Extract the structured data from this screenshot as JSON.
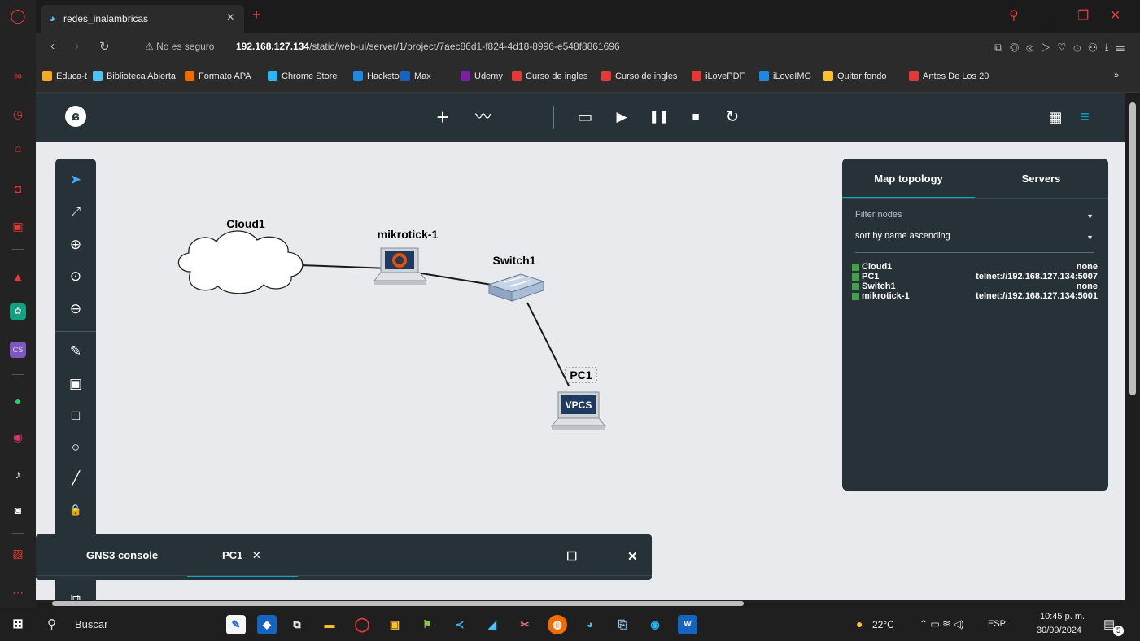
{
  "browser": {
    "tab_title": "redes_inalambricas",
    "tab_close": "×",
    "new_tab": "+",
    "security": "⚠ No es seguro",
    "url_host": "192.168.127.134",
    "url_path": "/static/web-ui/server/1/project/7aec86d1-f824-4d18-8996-e548f8861696",
    "bookmarks": [
      {
        "label": "Educa-t",
        "color": "#f9a825"
      },
      {
        "label": "Biblioteca Abierta",
        "color": "#4fc3f7"
      },
      {
        "label": "Formato APA",
        "color": "#ef6c00"
      },
      {
        "label": "Chrome Store",
        "color": "#29b6f6"
      },
      {
        "label": "Hackstore",
        "color": "#1e88e5"
      },
      {
        "label": "Max",
        "color": "#1565c0"
      },
      {
        "label": "Udemy",
        "color": "#7b1fa2"
      },
      {
        "label": "Curso de ingles",
        "color": "#e53935"
      },
      {
        "label": "Curso de ingles",
        "color": "#e53935"
      },
      {
        "label": "iLovePDF",
        "color": "#e53935"
      },
      {
        "label": "iLoveIMG",
        "color": "#1e88e5"
      },
      {
        "label": "Quitar fondo",
        "color": "#fbc02d"
      },
      {
        "label": "Antes De Los 20",
        "color": "#e53935"
      }
    ],
    "bookmarks_more": "»"
  },
  "gns3": {
    "logo": "ɕ",
    "toolbar": {
      "add": "+",
      "capture": "〰",
      "console": "▭",
      "start": "▶",
      "pause": "❚❚",
      "stop": "■",
      "reload": "↻",
      "grid": "▦",
      "list": "≡"
    },
    "tools": {
      "select": "➤",
      "fit": "⤢",
      "zoom_in": "⊕",
      "reset_zoom": "⊙",
      "zoom_out": "⊖",
      "draw": "✎",
      "image": "▣",
      "rectangle": "□",
      "ellipse": "○",
      "line": "╱",
      "lock": "🔒",
      "screenshot": "◙",
      "terminal": "⧉"
    },
    "nodes": [
      {
        "label": "Cloud1"
      },
      {
        "label": "mikrotick-1"
      },
      {
        "label": "Switch1"
      },
      {
        "label": "PC1"
      }
    ],
    "vpcs_text": "VPCS",
    "links": [
      {
        "from": "Cloud1",
        "to": "mikrotick-1"
      },
      {
        "from": "mikrotick-1",
        "to": "Switch1"
      },
      {
        "from": "Switch1",
        "to": "PC1"
      }
    ],
    "panel": {
      "tab_map": "Map topology",
      "tab_servers": "Servers",
      "filter_label": "Filter nodes",
      "sort_value": "sort by name ascending",
      "caret": "▼",
      "rows": [
        {
          "name": "Cloud1",
          "console": "none",
          "status": "#43a047"
        },
        {
          "name": "PC1",
          "console": "telnet://192.168.127.134:5007",
          "status": "#43a047"
        },
        {
          "name": "Switch1",
          "console": "none",
          "status": "#43a047"
        },
        {
          "name": "mikrotick-1",
          "console": "telnet://192.168.127.134:5001",
          "status": "#43a047"
        }
      ]
    },
    "console": {
      "tab_gns3": "GNS3 console",
      "tab_pc1": "PC1",
      "close_tab": "✕",
      "maximize": "☐",
      "close": "✕"
    }
  },
  "taskbar": {
    "search_placeholder": "Buscar",
    "weather": "22°C",
    "lang": "ESP",
    "time": "10:45 p. m.",
    "date": "30/09/2024",
    "notif_count": "5"
  }
}
